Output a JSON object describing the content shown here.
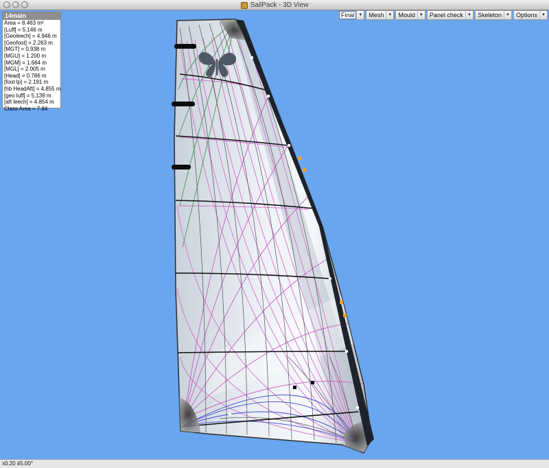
{
  "window": {
    "title": "SailPack - 3D View"
  },
  "toolbar": {
    "items": [
      {
        "label": "Final",
        "active": true
      },
      {
        "label": "Mesh",
        "active": false
      },
      {
        "label": "Mould",
        "active": false
      },
      {
        "label": "Panel check",
        "active": false
      },
      {
        "label": "Skeleton",
        "active": false
      },
      {
        "label": "Options",
        "active": false
      }
    ]
  },
  "info_panel": {
    "title": "14main",
    "lines": [
      "Area = 8.463 m²",
      "[Luff] = 5.146 m",
      "[Geoleech] = 4.946 m",
      "[Geofoot] = 2.263 m",
      "[MGT] = 0.938 m",
      "[MGU] = 1.200 m",
      "[MGM] = 1.664 m",
      "[MGL] = 2.005 m",
      "[Head] = 0.786 m",
      "[foot lp] = 2.191 m",
      "[hb HeadAft] = 4.855 m",
      "[geo luff] = 5.139 m",
      "[aft leech] = 4.854 m",
      "Class Area = 7.84"
    ]
  },
  "status": {
    "text": "x0.20  45.00°"
  },
  "colors": {
    "background": "#6aa6f0",
    "sail_cloth": "#e2e8ee",
    "panel_magenta": "#d36fcf",
    "panel_green": "#3e9a52",
    "luff_tape": "#1c232b",
    "marker_orange": "#f2a216"
  },
  "icons": {
    "app": "sailpack-app-icon",
    "insignia": "butterfly-icon"
  }
}
